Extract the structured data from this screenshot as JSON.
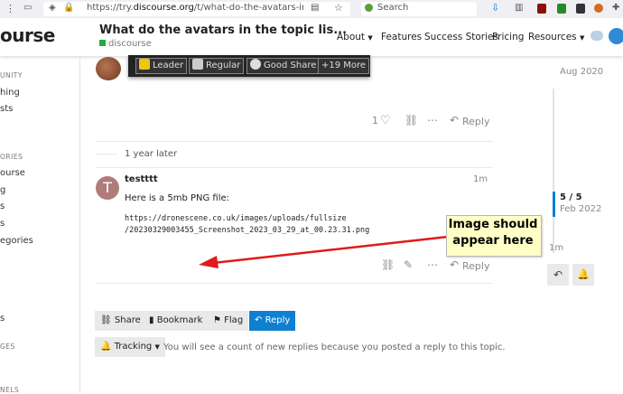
{
  "browser": {
    "url_prefix": "https://try.",
    "url_domain": "discourse.org",
    "url_suffix": "/t/what-do-the-avatars-in-the-topic-list-m",
    "search_placeholder": "Search"
  },
  "header": {
    "logo": "ourse",
    "title": "What do the avatars in the topic lis...",
    "category": "discourse",
    "nav": [
      "About",
      "Features",
      "Success Stories",
      "Pricing",
      "Resources"
    ]
  },
  "sidebar": {
    "h1": "UNITY",
    "items1": [
      "hing",
      "sts"
    ],
    "h2": "ORIES",
    "items2": [
      "ourse",
      "g",
      "s",
      "s",
      "egories"
    ],
    "items3": [
      "s"
    ],
    "h3": "GES",
    "h4": "NELS"
  },
  "badges": [
    {
      "label": "Leader",
      "color": "#f1c40f"
    },
    {
      "label": "Regular",
      "color": "#cccccc"
    },
    {
      "label": "Good Share",
      "color": "#dddddd"
    },
    {
      "label": "+19 More",
      "color": ""
    }
  ],
  "post1_controls": {
    "likes": "1",
    "reply": "Reply"
  },
  "time_gap": "1 year later",
  "post2": {
    "avatar_letter": "T",
    "username": "testttt",
    "age": "1m",
    "text": "Here is a 5mb PNG file:",
    "link_line1": "https://dronescene.co.uk/images/uploads/fullsize",
    "link_line2": "/20230329003455_Screenshot_2023_03_29_at_00.23.31.png",
    "reply": "Reply"
  },
  "callout": {
    "line1": "Image should",
    "line2": "appear here"
  },
  "footer_buttons": {
    "share": "Share",
    "bookmark": "Bookmark",
    "flag": "Flag",
    "reply": "Reply"
  },
  "tracking": {
    "label": "Tracking",
    "message": "You will see a count of new replies because you posted a reply to this topic."
  },
  "timeline": {
    "start": "Aug 2020",
    "position": "5 / 5",
    "date": "Feb 2022",
    "end": "1m"
  },
  "colors": {
    "accent": "#0f7fd1",
    "callout_bg": "#ffffc6",
    "arrow": "#e01b1b"
  }
}
